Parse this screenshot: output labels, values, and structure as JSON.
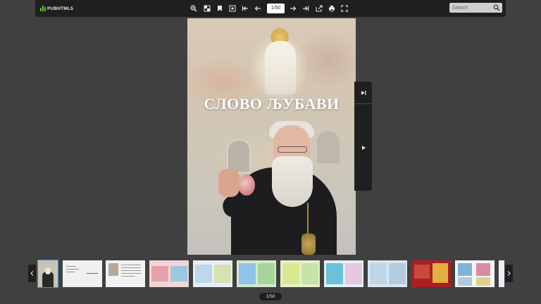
{
  "toolbar": {
    "logo_text": "PUBHTML5",
    "page_input_value": "1/50",
    "search_placeholder": "Search",
    "icons": [
      "zoom-in-icon",
      "thumbnails-icon",
      "bookmark-icon",
      "fit-screen-icon",
      "first-page-icon",
      "previous-page-icon",
      "next-page-icon",
      "last-page-icon",
      "share-icon",
      "print-icon",
      "fullscreen-icon",
      "search-icon"
    ]
  },
  "book": {
    "cover_title": "СЛОВО ЉУБАВИ"
  },
  "side_panel": {
    "icons": [
      "end-page-icon",
      "play-icon"
    ]
  },
  "thumbnails": {
    "count_visible": 11,
    "colors": [
      "#c9c3b6",
      "#f0f0f0",
      "#f2f2f2",
      "#f0d6d6",
      "#e6eef4",
      "#d4e8d0",
      "#e8f0c8",
      "#e4f0f6",
      "#d9e6ef",
      "#a81f24",
      "#f4f4f4"
    ]
  },
  "footer": {
    "page_indicator": "1/50"
  },
  "colors": {
    "background": "#404040",
    "toolbar": "#1f1f1f",
    "accent": "#5bc236",
    "active_thumb_border": "#3d8fd9"
  }
}
